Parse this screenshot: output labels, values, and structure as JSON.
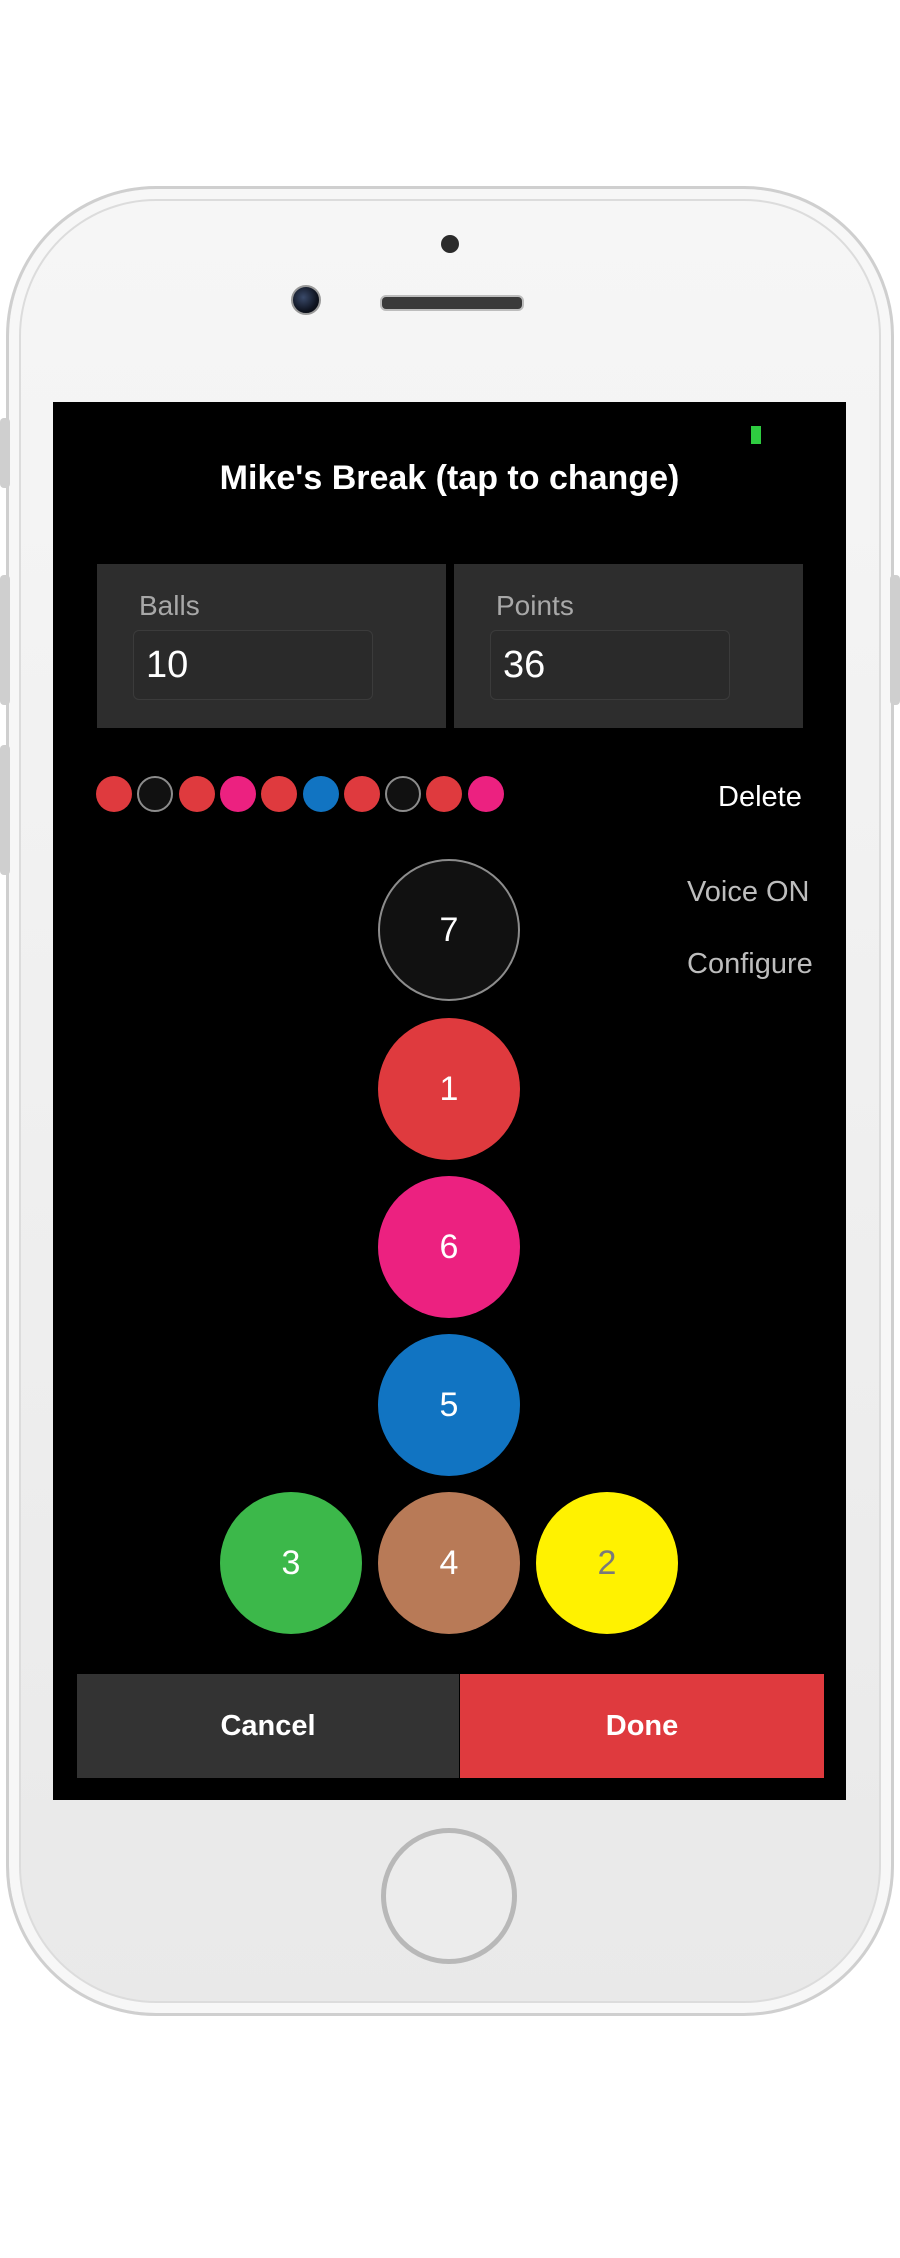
{
  "screen": {
    "title": "Mike's Break (tap to change)",
    "stats": {
      "balls_label": "Balls",
      "balls_value": "10",
      "points_label": "Points",
      "points_value": "36"
    },
    "break_history": [
      "red",
      "black",
      "red",
      "pink",
      "red",
      "blue",
      "red",
      "black",
      "red",
      "pink"
    ],
    "delete_label": "Delete",
    "voice_label": "Voice ON",
    "configure_label": "Configure",
    "balls": [
      {
        "name": "black",
        "value": "7",
        "color": "#111111",
        "text_color": "#ffffff"
      },
      {
        "name": "red",
        "value": "1",
        "color": "#df3a3e",
        "text_color": "#ffffff"
      },
      {
        "name": "pink",
        "value": "6",
        "color": "#ec2180",
        "text_color": "#ffffff"
      },
      {
        "name": "blue",
        "value": "5",
        "color": "#1174c2",
        "text_color": "#ffffff"
      },
      {
        "name": "green",
        "value": "3",
        "color": "#3cb84a",
        "text_color": "#ffffff"
      },
      {
        "name": "brown",
        "value": "4",
        "color": "#b87a57",
        "text_color": "#ffffff"
      },
      {
        "name": "yellow",
        "value": "2",
        "color": "#fff200",
        "text_color": "#7a7a7a"
      }
    ],
    "cancel_label": "Cancel",
    "done_label": "Done"
  },
  "colors": {
    "red": "#df3a3e",
    "black": "#111111",
    "pink": "#ec2180",
    "blue": "#1174c2",
    "battery": "#2ecc40",
    "cancel_bg": "#333333",
    "done_bg": "#df3a3e"
  }
}
